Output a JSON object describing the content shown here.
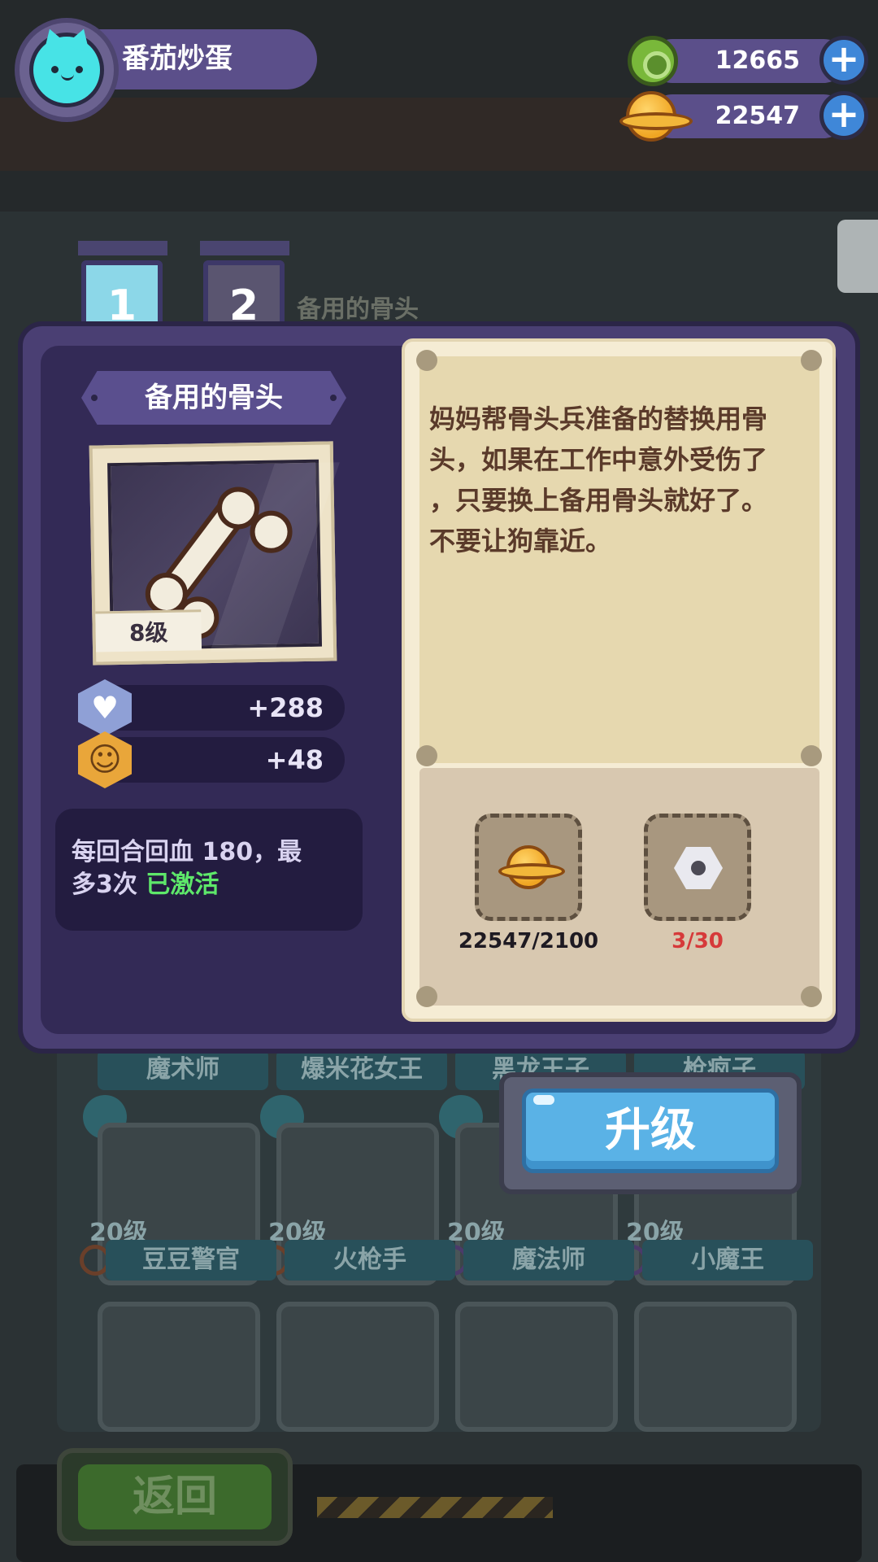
{
  "player": {
    "name": "番茄炒蛋"
  },
  "currency": {
    "gems": {
      "value": "12665",
      "icon": "gem-icon"
    },
    "coins": {
      "value": "22547",
      "icon": "coin-icon"
    }
  },
  "tabs": [
    {
      "label": "1"
    },
    {
      "label": "2"
    }
  ],
  "background": {
    "item_title": "备用的骨头",
    "row1_names": [
      "魔术师",
      "爆米花女王",
      "黑龙王子",
      "枪疯子"
    ],
    "row2_levels": [
      "20级",
      "20级",
      "20级",
      "20级"
    ],
    "row2_names": [
      "豆豆警官",
      "火枪手",
      "魔法师",
      "小魔王"
    ],
    "back_label": "返回"
  },
  "item": {
    "name": "备用的骨头",
    "level": "8级",
    "stats": [
      {
        "icon": "heart-hex-icon",
        "value": "+288"
      },
      {
        "icon": "smile-hex-icon",
        "value": "+48"
      }
    ],
    "effect_line1": "每回合回血 180，最",
    "effect_line2": "多3次",
    "effect_status": "已激活",
    "description": [
      "妈妈帮骨头兵准备的替换用骨",
      "头，如果在工作中意外受伤了",
      "，只要换上备用骨头就好了。",
      "不要让狗靠近。"
    ]
  },
  "costs": [
    {
      "icon": "coin-icon",
      "label": "22547/2100",
      "color": "#1e1a22"
    },
    {
      "icon": "nut-icon",
      "label": "3/30",
      "color": "#d63a3a"
    }
  ],
  "upgrade_button": {
    "label": "升级"
  },
  "colors": {
    "panel": "#4a3f73",
    "accent": "#5ab2e6",
    "active_green": "#5ee86a",
    "insufficient_red": "#d63a3a"
  }
}
